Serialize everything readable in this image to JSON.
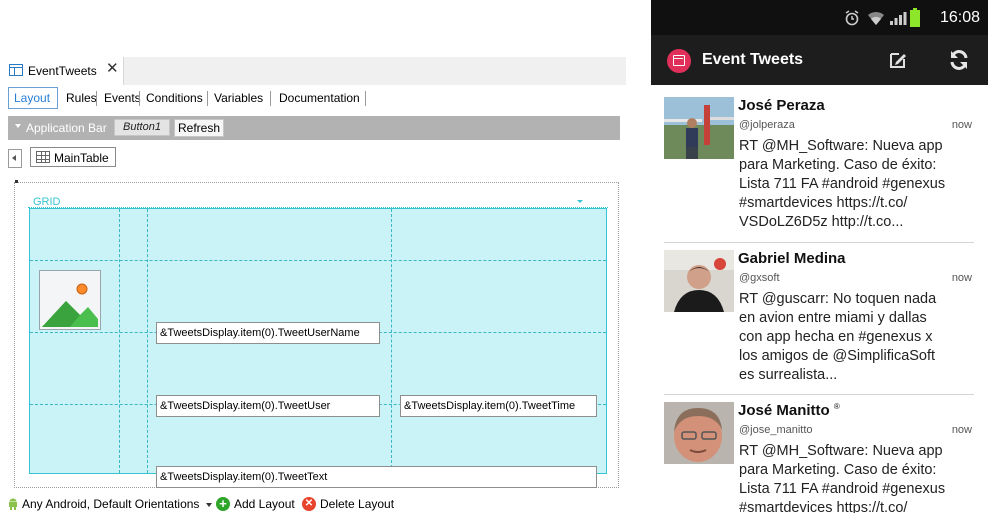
{
  "ide": {
    "doc_tab": {
      "title": "EventTweets",
      "close": "✕"
    },
    "subtabs": [
      "Layout",
      "Rules",
      "Events",
      "Conditions",
      "Variables",
      "Documentation"
    ],
    "app_bar": {
      "title": "Application Bar",
      "buttons": [
        "Button1",
        "Refresh"
      ]
    },
    "main_table": "MainTable",
    "grid": {
      "title": "GRID",
      "fields": {
        "user_name": "&TweetsDisplay.item(0).TweetUserName",
        "user": "&TweetsDisplay.item(0).TweetUser",
        "time": "&TweetsDisplay.item(0).TweetTime",
        "text": "&TweetsDisplay.item(0).TweetText"
      }
    },
    "footer": {
      "platform": "Any Android, Default Orientations",
      "add_layout": "Add Layout",
      "delete_layout": "Delete Layout"
    }
  },
  "phone": {
    "status_bar": {
      "time": "16:08"
    },
    "action_bar": {
      "title": "Event Tweets"
    },
    "tweets": [
      {
        "name": "José Peraza",
        "handle": "@jolperaza",
        "time": "now",
        "text": "RT @MH_Software: Nueva app\npara Marketing. Caso de éxito:\nLista 711 FA #android #genexus\n#smartdevices https://t.co/\nVSDoLZ6D5z http://t.co..."
      },
      {
        "name": "Gabriel Medina",
        "handle": "@gxsoft",
        "time": "now",
        "text": "RT @guscarr: No toquen nada\nen avion entre miami y dallas\ncon app hecha en #genexus x\nlos amigos de @SimplificaSoft\nes surrealista..."
      },
      {
        "name": "José Manitto",
        "name_mark": "®",
        "handle": "@jose_manitto",
        "time": "now",
        "text": "RT @MH_Software: Nueva app\npara Marketing. Caso de éxito:\nLista 711 FA #android #genexus\n#smartdevices https://t.co/"
      }
    ]
  },
  "colors": {
    "grid_fill": "#c9f3f7",
    "grid_line": "#36c4d2",
    "app_bar": "#b2b2b2",
    "accent_blue": "#2a7fd4",
    "app_icon": "#e0305a"
  },
  "icons": [
    "window-tab-icon",
    "close-icon",
    "chevron-left-icon",
    "table-icon",
    "image-placeholder-icon",
    "android-icon",
    "add-icon",
    "delete-icon",
    "alarm-icon",
    "wifi-icon",
    "signal-icon",
    "battery-icon",
    "calendar-icon",
    "compose-icon",
    "refresh-icon"
  ]
}
